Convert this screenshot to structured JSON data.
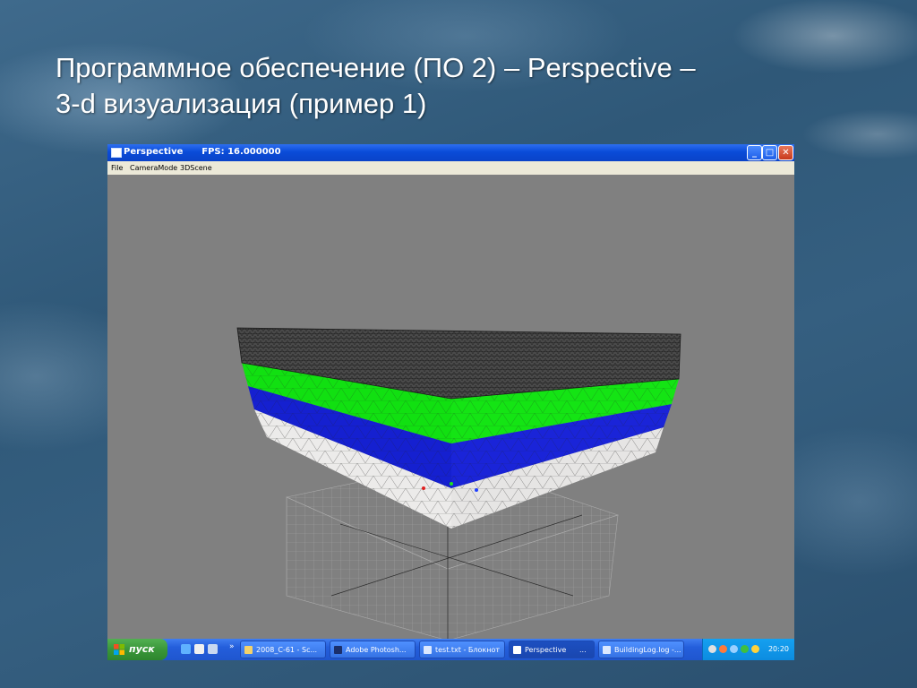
{
  "slide": {
    "title_line1": "Программное обеспечение (ПО 2) – Perspective –",
    "title_line2": "3-d визуализация (пример 1)"
  },
  "window": {
    "title": "Perspective      FPS: 16.000000",
    "controls": {
      "minimize": "_",
      "maximize": "□",
      "close": "✕"
    },
    "menu": [
      "File",
      "CameraMode",
      "3DScene"
    ]
  },
  "scene": {
    "layer_colors": {
      "top": "#4a4a4a",
      "green": "#11e011",
      "blue": "#1520d0",
      "white": "#ecebea",
      "background": "#808080",
      "grid": "#a8a8a8"
    }
  },
  "taskbar": {
    "start_label": "пуск",
    "quick_launch": [
      "ie-icon",
      "media-player-icon",
      "outlook-icon"
    ],
    "quick_launch_more": "»",
    "tasks": [
      {
        "label": "2008_C-61 - Sc...",
        "icon": "folder-icon",
        "active": false
      },
      {
        "label": "Adobe Photosh...",
        "icon": "photoshop-icon",
        "active": false
      },
      {
        "label": "test.txt - Блокнот",
        "icon": "notepad-icon",
        "active": false
      },
      {
        "label": "Perspective",
        "icon": "window-icon",
        "active": true,
        "suffix": "..."
      },
      {
        "label": "BuildingLog.log -...",
        "icon": "notepad-icon",
        "active": false
      }
    ],
    "clock": "20:20"
  }
}
